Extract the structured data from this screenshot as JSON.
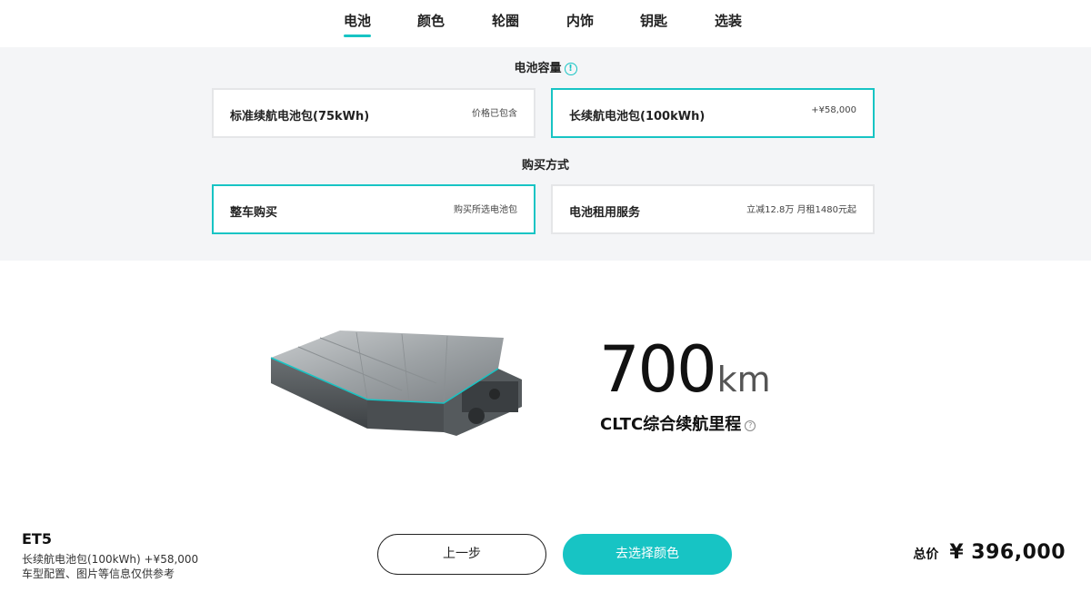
{
  "tabs": [
    {
      "label": "电池",
      "active": true
    },
    {
      "label": "颜色",
      "active": false
    },
    {
      "label": "轮圈",
      "active": false
    },
    {
      "label": "内饰",
      "active": false
    },
    {
      "label": "钥匙",
      "active": false
    },
    {
      "label": "选装",
      "active": false
    }
  ],
  "battery_capacity": {
    "title": "电池容量",
    "options": [
      {
        "label": "标准续航电池包(75kWh)",
        "note": "价格已包含",
        "selected": false
      },
      {
        "label": "长续航电池包(100kWh)",
        "note": "+¥58,000",
        "selected": true
      }
    ]
  },
  "purchase_method": {
    "title": "购买方式",
    "options": [
      {
        "label": "整车购买",
        "note": "购买所选电池包",
        "selected": true
      },
      {
        "label": "电池租用服务",
        "note": "立减12.8万 月租1480元起",
        "selected": false
      }
    ]
  },
  "range": {
    "value": "700",
    "unit": "km",
    "label": "CLTC综合续航里程"
  },
  "footer": {
    "model": "ET5",
    "selection": "长续航电池包(100kWh) +¥58,000",
    "disclaimer": "车型配置、图片等信息仅供参考",
    "prev_button": "上一步",
    "next_button": "去选择颜色",
    "total_label": "总价",
    "total_amount": "¥ 396,000"
  },
  "colors": {
    "accent": "#17c4c4",
    "panel_bg": "#f4f5f7"
  }
}
